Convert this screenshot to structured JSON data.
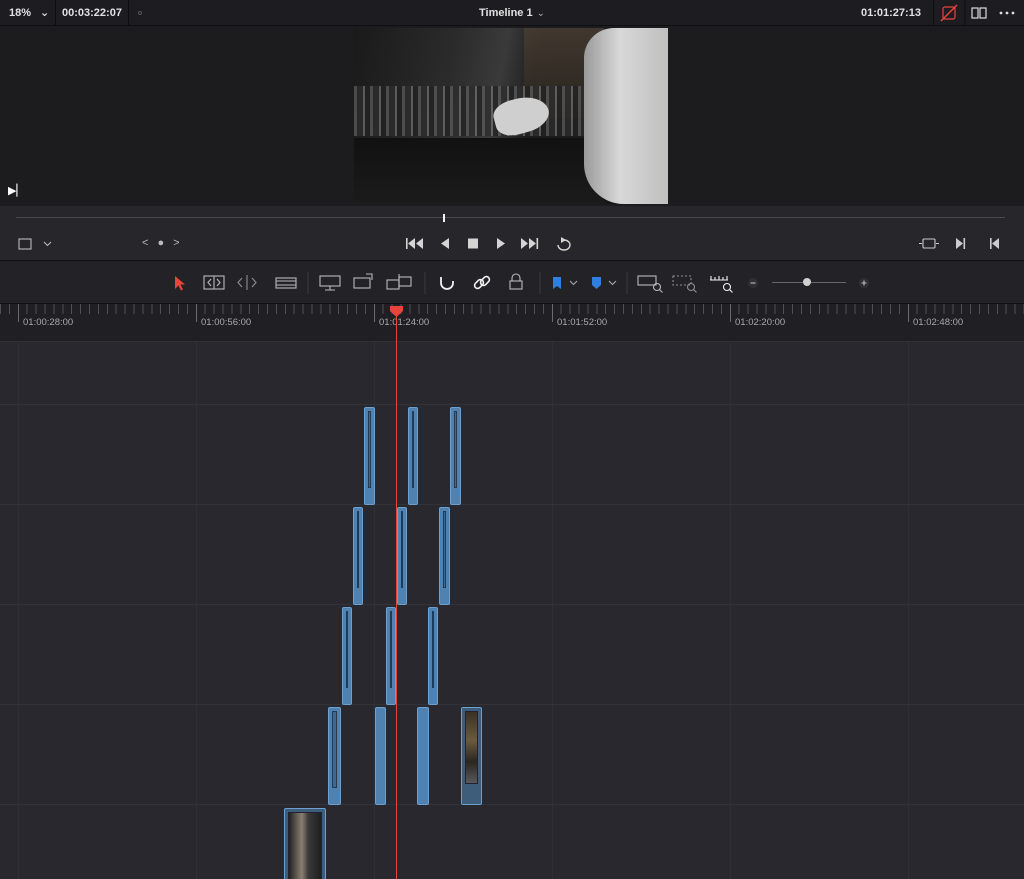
{
  "topbar": {
    "zoom": "18%",
    "zoom_chevron": "⌄",
    "source_timecode": "00:03:22:07",
    "timeline_title": "Timeline 1",
    "title_chevron": "⌄",
    "record_timecode": "01:01:27:13",
    "icons": [
      "bypass-icon",
      "dual-viewer-icon",
      "more-icon"
    ]
  },
  "viewer": {
    "mark_glyph": "▶▏"
  },
  "transport": {
    "nav": "< ● >",
    "viewer_options": "⬚ ⌄",
    "buttons": [
      "⏮",
      "◀",
      "■",
      "▶",
      "⏭",
      "↻"
    ],
    "right_buttons": [
      "⊡",
      "▶|",
      "|◀"
    ]
  },
  "toolbar": {
    "tools": [
      "➤",
      "⟦⟧",
      "⟨|⟩",
      "▭",
      "⊟",
      "⊞",
      "⇅",
      "∪",
      "⚯",
      "⊡",
      "▾",
      "▾",
      "⌕",
      "⌕",
      "⌕",
      "−",
      "+"
    ]
  },
  "ruler": {
    "labels": [
      "01:00:28:00",
      "01:00:56:00",
      "01:01:24:00",
      "01:01:52:00",
      "01:02:20:00",
      "01:02:48:00"
    ]
  },
  "colors": {
    "accent_red": "#e8453a",
    "clip_blue": "#4f82b0",
    "marker_blue": "#2f7fe0",
    "background": "#1e1f24"
  }
}
